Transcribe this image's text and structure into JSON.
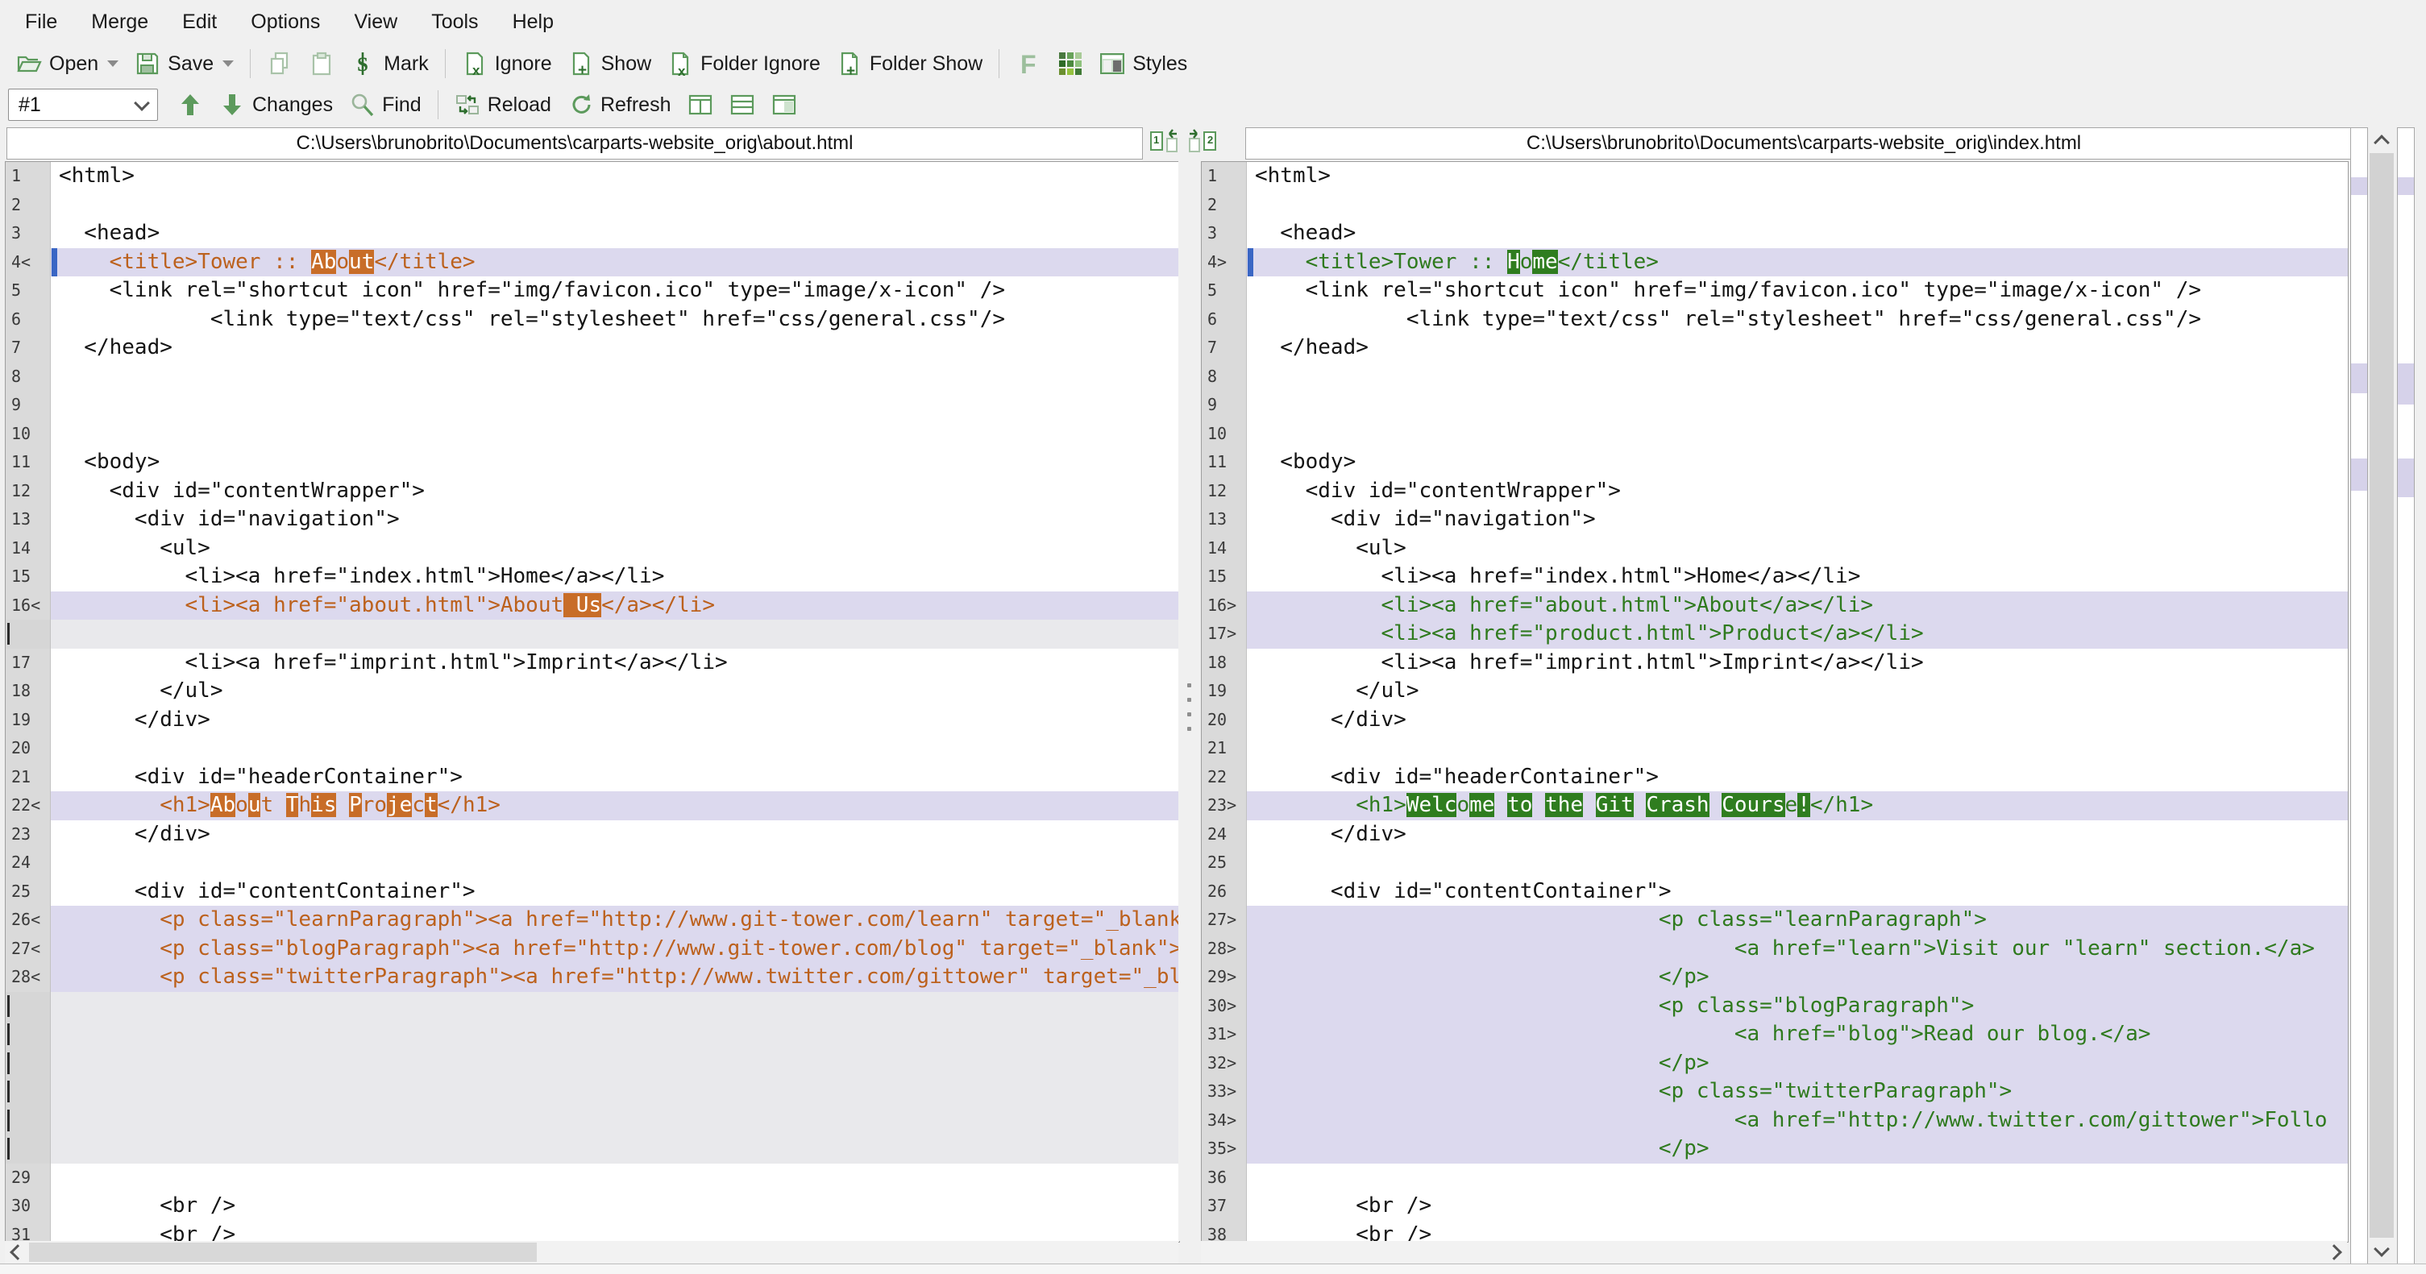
{
  "app": "WinMerge file compare",
  "colors": {
    "diff_line_bg": "#dcd9ee",
    "ghost_bg": "#e9e9ec",
    "left_diff_text": "#bc611d",
    "left_diff_block": "#c86d28",
    "right_diff_text": "#2f7a1e",
    "right_diff_block": "#2f7d1f",
    "caret_marker": "#3a66c4",
    "toolbar_green": "#5c9a5c"
  },
  "menu": {
    "items": [
      "File",
      "Merge",
      "Edit",
      "Options",
      "View",
      "Tools",
      "Help"
    ]
  },
  "toolbar_main": [
    {
      "icon": "open-folder-icon",
      "label": "Open",
      "dropdown": true
    },
    {
      "icon": "save-icon",
      "label": "Save",
      "dropdown": true
    },
    {
      "sep": true
    },
    {
      "icon": "copy-icon",
      "label": ""
    },
    {
      "icon": "paste-icon",
      "label": ""
    },
    {
      "icon": "mark-icon",
      "label": "Mark"
    },
    {
      "sep": true
    },
    {
      "icon": "ignore-icon",
      "label": "Ignore"
    },
    {
      "icon": "show-icon",
      "label": "Show"
    },
    {
      "icon": "folder-ignore-icon",
      "label": "Folder Ignore"
    },
    {
      "icon": "folder-show-icon",
      "label": "Folder Show"
    },
    {
      "sep": true
    },
    {
      "icon": "font-icon",
      "label": ""
    },
    {
      "icon": "grid-icon",
      "label": ""
    },
    {
      "icon": "styles-icon",
      "label": "Styles"
    }
  ],
  "toolbar_nav": {
    "diff_selector_value": "#1",
    "buttons": [
      {
        "icon": "arrow-up-icon",
        "label": ""
      },
      {
        "icon": "arrow-down-icon",
        "label": "Changes"
      },
      {
        "icon": "find-icon",
        "label": "Find"
      },
      {
        "sep": true
      },
      {
        "icon": "reload-icon",
        "label": "Reload"
      },
      {
        "icon": "refresh-icon",
        "label": "Refresh"
      },
      {
        "icon": "layout-columns-icon",
        "label": ""
      },
      {
        "icon": "layout-rows-icon",
        "label": ""
      },
      {
        "icon": "layout-single-icon",
        "label": ""
      }
    ]
  },
  "headers": {
    "left_path": "C:\\Users\\brunobrito\\Documents\\carparts-website_orig\\about.html",
    "right_path": "C:\\Users\\brunobrito\\Documents\\carparts-website_orig\\index.html"
  },
  "panes": {
    "left": {
      "lines": [
        {
          "n": "1",
          "t": [
            [
              "<html>",
              0
            ]
          ]
        },
        {
          "n": "2",
          "t": []
        },
        {
          "n": "3",
          "t": [
            [
              "  <head>",
              0
            ]
          ]
        },
        {
          "n": "4",
          "m": "<",
          "bg": "d",
          "caret": true,
          "t": [
            [
              "    <title>Tower :: ",
              1
            ],
            [
              "Ab",
              2
            ],
            [
              "o",
              1
            ],
            [
              "ut",
              2
            ],
            [
              "</title>",
              1
            ]
          ]
        },
        {
          "n": "5",
          "t": [
            [
              "    <link rel=\"shortcut icon\" href=\"img/favicon.ico\" type=\"image/x-icon\" />",
              0
            ]
          ]
        },
        {
          "n": "6",
          "t": [
            [
              "            <link type=\"text/css\" rel=\"stylesheet\" href=\"css/general.css\"/>",
              0
            ]
          ]
        },
        {
          "n": "7",
          "t": [
            [
              "  </head>",
              0
            ]
          ]
        },
        {
          "n": "8",
          "t": []
        },
        {
          "n": "9",
          "t": []
        },
        {
          "n": "10",
          "t": []
        },
        {
          "n": "11",
          "t": [
            [
              "  <body>",
              0
            ]
          ]
        },
        {
          "n": "12",
          "t": [
            [
              "    <div id=\"contentWrapper\">",
              0
            ]
          ]
        },
        {
          "n": "13",
          "t": [
            [
              "      <div id=\"navigation\">",
              0
            ]
          ]
        },
        {
          "n": "14",
          "t": [
            [
              "        <ul>",
              0
            ]
          ]
        },
        {
          "n": "15",
          "t": [
            [
              "          <li><a href=\"index.html\">Home</a></li>",
              0
            ]
          ]
        },
        {
          "n": "16",
          "m": "<",
          "bg": "d",
          "t": [
            [
              "          <li><a href=\"about.html\">About",
              1
            ],
            [
              " Us",
              2
            ],
            [
              "</a></li>",
              1
            ]
          ]
        },
        {
          "ghost": true
        },
        {
          "n": "17",
          "t": [
            [
              "          <li><a href=\"imprint.html\">Imprint</a></li>",
              0
            ]
          ]
        },
        {
          "n": "18",
          "t": [
            [
              "        </ul>",
              0
            ]
          ]
        },
        {
          "n": "19",
          "t": [
            [
              "      </div>",
              0
            ]
          ]
        },
        {
          "n": "20",
          "t": []
        },
        {
          "n": "21",
          "t": [
            [
              "      <div id=\"headerContainer\">",
              0
            ]
          ]
        },
        {
          "n": "22",
          "m": "<",
          "bg": "d",
          "t": [
            [
              "        <h1>",
              1
            ],
            [
              "Ab",
              2
            ],
            [
              "o",
              1
            ],
            [
              "u",
              2
            ],
            [
              "t ",
              1
            ],
            [
              "T",
              2
            ],
            [
              "h",
              1
            ],
            [
              "is",
              2
            ],
            [
              " ",
              1
            ],
            [
              "P",
              2
            ],
            [
              "ro",
              1
            ],
            [
              "je",
              2
            ],
            [
              "c",
              1
            ],
            [
              "t",
              2
            ],
            [
              "</h1>",
              1
            ]
          ]
        },
        {
          "n": "23",
          "t": [
            [
              "      </div>",
              0
            ]
          ]
        },
        {
          "n": "24",
          "t": []
        },
        {
          "n": "25",
          "t": [
            [
              "      <div id=\"contentContainer\">",
              0
            ]
          ]
        },
        {
          "n": "26",
          "m": "<",
          "bg": "d",
          "t": [
            [
              "        <p class=\"learnParagraph\"><a href=\"http://www.git-tower.com/learn\" target=\"_blank\"",
              1
            ]
          ]
        },
        {
          "n": "27",
          "m": "<",
          "bg": "d",
          "t": [
            [
              "        <p class=\"blogParagraph\"><a href=\"http://www.git-tower.com/blog\" target=\"_blank\">R",
              1
            ]
          ]
        },
        {
          "n": "28",
          "m": "<",
          "bg": "d",
          "t": [
            [
              "        <p class=\"twitterParagraph\"><a href=\"http://www.twitter.com/gittower\" target=\"_bla",
              1
            ]
          ]
        },
        {
          "ghost": true
        },
        {
          "ghost": true
        },
        {
          "ghost": true
        },
        {
          "ghost": true
        },
        {
          "ghost": true
        },
        {
          "ghost": true
        },
        {
          "n": "29",
          "t": []
        },
        {
          "n": "30",
          "t": [
            [
              "        <br />",
              0
            ]
          ]
        },
        {
          "n": "31",
          "t": [
            [
              "        <br />",
              0
            ]
          ]
        }
      ]
    },
    "right": {
      "lines": [
        {
          "n": "1",
          "t": [
            [
              "<html>",
              0
            ]
          ]
        },
        {
          "n": "2",
          "t": []
        },
        {
          "n": "3",
          "t": [
            [
              "  <head>",
              0
            ]
          ]
        },
        {
          "n": "4",
          "m": ">",
          "bg": "d",
          "caret": true,
          "t": [
            [
              "    <title>Tower :: ",
              1
            ],
            [
              "H",
              2
            ],
            [
              "o",
              1
            ],
            [
              "me",
              2
            ],
            [
              "</title>",
              1
            ]
          ]
        },
        {
          "n": "5",
          "t": [
            [
              "    <link rel=\"shortcut icon\" href=\"img/favicon.ico\" type=\"image/x-icon\" />",
              0
            ]
          ]
        },
        {
          "n": "6",
          "t": [
            [
              "            <link type=\"text/css\" rel=\"stylesheet\" href=\"css/general.css\"/>",
              0
            ]
          ]
        },
        {
          "n": "7",
          "t": [
            [
              "  </head>",
              0
            ]
          ]
        },
        {
          "n": "8",
          "t": []
        },
        {
          "n": "9",
          "t": []
        },
        {
          "n": "10",
          "t": []
        },
        {
          "n": "11",
          "t": [
            [
              "  <body>",
              0
            ]
          ]
        },
        {
          "n": "12",
          "t": [
            [
              "    <div id=\"contentWrapper\">",
              0
            ]
          ]
        },
        {
          "n": "13",
          "t": [
            [
              "      <div id=\"navigation\">",
              0
            ]
          ]
        },
        {
          "n": "14",
          "t": [
            [
              "        <ul>",
              0
            ]
          ]
        },
        {
          "n": "15",
          "t": [
            [
              "          <li><a href=\"index.html\">Home</a></li>",
              0
            ]
          ]
        },
        {
          "n": "16",
          "m": ">",
          "bg": "d",
          "t": [
            [
              "          <li><a href=\"about.html\">About</a></li>",
              1
            ]
          ]
        },
        {
          "n": "17",
          "m": ">",
          "bg": "d",
          "t": [
            [
              "          <li><a href=\"product.html\">Product</a></li>",
              1
            ]
          ]
        },
        {
          "n": "18",
          "t": [
            [
              "          <li><a href=\"imprint.html\">Imprint</a></li>",
              0
            ]
          ]
        },
        {
          "n": "19",
          "t": [
            [
              "        </ul>",
              0
            ]
          ]
        },
        {
          "n": "20",
          "t": [
            [
              "      </div>",
              0
            ]
          ]
        },
        {
          "n": "21",
          "t": []
        },
        {
          "n": "22",
          "t": [
            [
              "      <div id=\"headerContainer\">",
              0
            ]
          ]
        },
        {
          "n": "23",
          "m": ">",
          "bg": "d",
          "t": [
            [
              "        <h1>",
              1
            ],
            [
              "Welc",
              2
            ],
            [
              "o",
              1
            ],
            [
              "me",
              2
            ],
            [
              " ",
              1
            ],
            [
              "to",
              2
            ],
            [
              " ",
              1
            ],
            [
              "the",
              2
            ],
            [
              " ",
              1
            ],
            [
              "Git",
              2
            ],
            [
              " ",
              1
            ],
            [
              "Crash",
              2
            ],
            [
              " ",
              1
            ],
            [
              "Cours",
              2
            ],
            [
              "e",
              1
            ],
            [
              "!",
              2
            ],
            [
              "</h1>",
              1
            ]
          ]
        },
        {
          "n": "24",
          "t": [
            [
              "      </div>",
              0
            ]
          ]
        },
        {
          "n": "25",
          "t": []
        },
        {
          "n": "26",
          "t": [
            [
              "      <div id=\"contentContainer\">",
              0
            ]
          ]
        },
        {
          "n": "27",
          "m": ">",
          "bg": "d",
          "t": [
            [
              "                                <p class=\"learnParagraph\">",
              1
            ]
          ]
        },
        {
          "n": "28",
          "m": ">",
          "bg": "d",
          "t": [
            [
              "                                      <a href=\"learn\">Visit our \"learn\" section.</a>",
              1
            ]
          ]
        },
        {
          "n": "29",
          "m": ">",
          "bg": "d",
          "t": [
            [
              "                                </p>",
              1
            ]
          ]
        },
        {
          "n": "30",
          "m": ">",
          "bg": "d",
          "t": [
            [
              "                                <p class=\"blogParagraph\">",
              1
            ]
          ]
        },
        {
          "n": "31",
          "m": ">",
          "bg": "d",
          "t": [
            [
              "                                      <a href=\"blog\">Read our blog.</a>",
              1
            ]
          ]
        },
        {
          "n": "32",
          "m": ">",
          "bg": "d",
          "t": [
            [
              "                                </p>",
              1
            ]
          ]
        },
        {
          "n": "33",
          "m": ">",
          "bg": "d",
          "t": [
            [
              "                                <p class=\"twitterParagraph\">",
              1
            ]
          ]
        },
        {
          "n": "34",
          "m": ">",
          "bg": "d",
          "t": [
            [
              "                                      <a href=\"http://www.twitter.com/gittower\">Follo",
              1
            ]
          ]
        },
        {
          "n": "35",
          "m": ">",
          "bg": "d",
          "t": [
            [
              "                                </p>",
              1
            ]
          ]
        },
        {
          "n": "36",
          "t": []
        },
        {
          "n": "37",
          "t": [
            [
              "        <br />",
              0
            ]
          ]
        },
        {
          "n": "38",
          "t": [
            [
              "        <br />",
              0
            ]
          ]
        }
      ]
    }
  },
  "location_bars": {
    "left_bands": [
      {
        "top": 4.3,
        "h": 1.6
      },
      {
        "top": 20.7,
        "h": 2.6
      },
      {
        "top": 29.1,
        "h": 2.8
      }
    ],
    "right_bands": [
      {
        "top": 4.3,
        "h": 1.6
      },
      {
        "top": 20.7,
        "h": 3.6
      },
      {
        "top": 29.1,
        "h": 3.4
      }
    ]
  }
}
